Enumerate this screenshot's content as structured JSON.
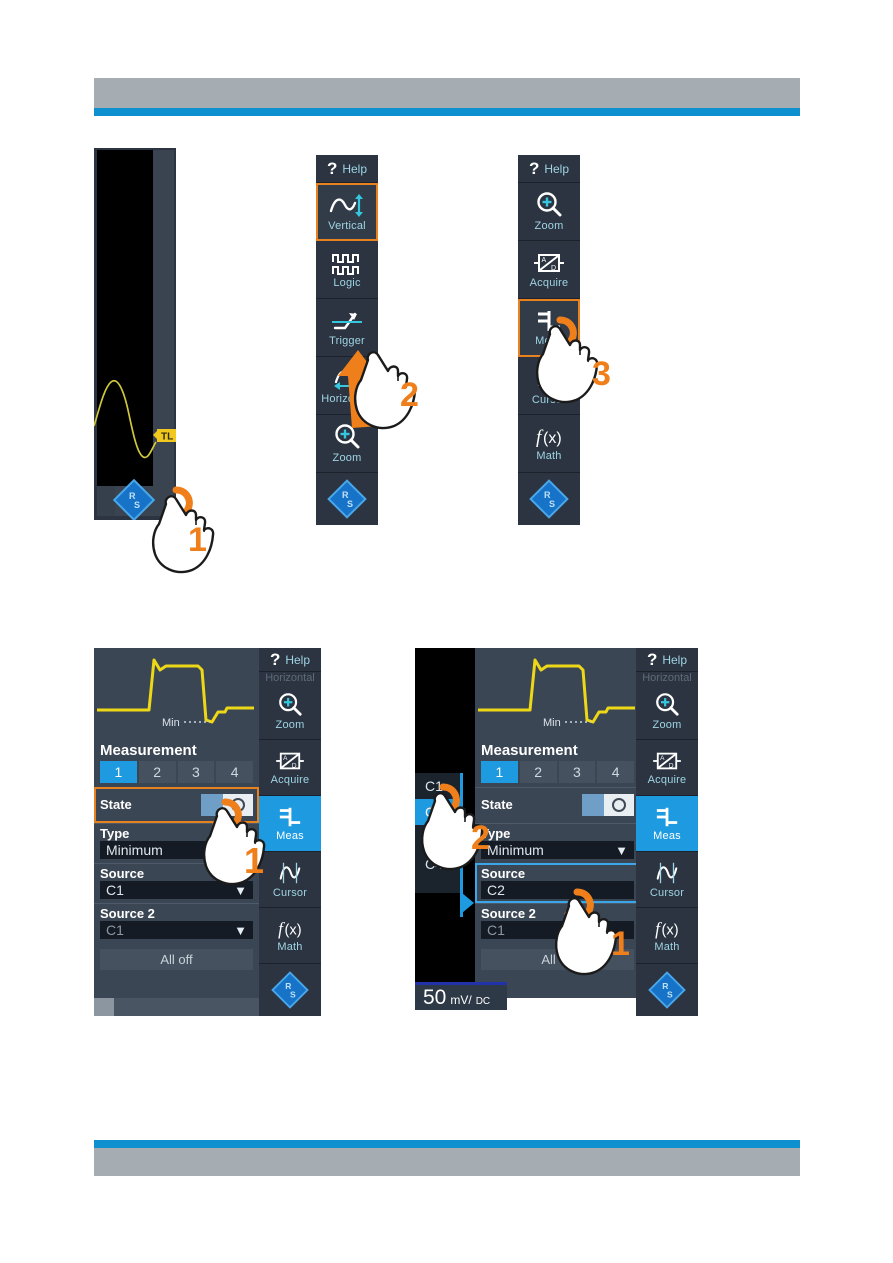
{
  "page": {
    "header_bar_color": "#a5adb2",
    "accent_blue": "#0d8fd0"
  },
  "figures": [
    {
      "id": "fig-step1-logo",
      "name": "scope-screen-with-rs-logo",
      "trigger_label": "TL",
      "step": "1"
    },
    {
      "id": "fig-step2-toolbar",
      "name": "toolbar-scroll-up",
      "step": "2",
      "help_label": "Help",
      "items": [
        {
          "label": "Vertical",
          "icon": "vertical-icon",
          "selected": true
        },
        {
          "label": "Logic",
          "icon": "logic-icon",
          "selected": false
        },
        {
          "label": "Trigger",
          "icon": "trigger-icon",
          "selected": false
        },
        {
          "label": "Horizontal",
          "icon": "horizontal-icon",
          "selected": false
        },
        {
          "label": "Zoom",
          "icon": "zoom-icon",
          "selected": false
        }
      ],
      "logo": "rohde-schwarz-logo"
    },
    {
      "id": "fig-step3-meas",
      "name": "toolbar-select-meas",
      "step": "3",
      "help_label": "Help",
      "items": [
        {
          "label": "Zoom",
          "icon": "zoom-icon",
          "selected": false
        },
        {
          "label": "Acquire",
          "icon": "acquire-icon",
          "selected": false
        },
        {
          "label": "Meas",
          "icon": "meas-icon",
          "selected": true
        },
        {
          "label": "Cursor",
          "icon": "cursor-icon",
          "selected": false
        },
        {
          "label": "Math",
          "icon": "math-icon",
          "selected": false
        }
      ],
      "logo": "rohde-schwarz-logo"
    },
    {
      "id": "fig-meas-dialog-state",
      "name": "measurement-dialog-enable-state",
      "step": "1",
      "waveform_label": "Min",
      "dialog": {
        "title": "Measurement",
        "tabs": [
          "1",
          "2",
          "3",
          "4"
        ],
        "active_tab": "1",
        "fields": [
          {
            "key": "State",
            "value": "",
            "kind": "toggle",
            "highlight": "orange"
          },
          {
            "key": "Type",
            "value": "Minimum",
            "kind": "dropdown"
          },
          {
            "key": "Source",
            "value": "C1",
            "kind": "dropdown"
          },
          {
            "key": "Source 2",
            "value": "C1",
            "kind": "dropdown",
            "dim": true
          }
        ],
        "all_off_label": "All off"
      },
      "toolbar": {
        "help_label": "Help",
        "cut_label": "Horizontal",
        "items": [
          {
            "label": "Zoom",
            "icon": "zoom-icon",
            "selected": false
          },
          {
            "label": "Acquire",
            "icon": "acquire-icon",
            "selected": false
          },
          {
            "label": "Meas",
            "icon": "meas-icon",
            "selected": true
          },
          {
            "label": "Cursor",
            "icon": "cursor-icon",
            "selected": false
          },
          {
            "label": "Math",
            "icon": "math-icon",
            "selected": false
          }
        ],
        "logo": "rohde-schwarz-logo"
      }
    },
    {
      "id": "fig-meas-dialog-source",
      "name": "measurement-dialog-select-source",
      "steps": [
        "1",
        "2"
      ],
      "waveform_label": "Min",
      "vertical_scale": {
        "value": "50",
        "unit": "mV/",
        "coupling": "DC"
      },
      "channel_list": {
        "options": [
          "C1",
          "C2",
          "C3",
          "C4"
        ],
        "selected": "C2"
      },
      "dialog": {
        "title": "Measurement",
        "tabs": [
          "1",
          "2",
          "3",
          "4"
        ],
        "active_tab": "1",
        "fields": [
          {
            "key": "State",
            "value": "",
            "kind": "toggle"
          },
          {
            "key": "Type",
            "value": "Minimum",
            "kind": "dropdown"
          },
          {
            "key": "Source",
            "value": "C2",
            "kind": "dropdown",
            "highlight": "blue"
          },
          {
            "key": "Source 2",
            "value": "C1",
            "kind": "dropdown",
            "dim": true
          }
        ],
        "all_off_label": "All off"
      },
      "toolbar": {
        "help_label": "Help",
        "cut_label": "Horizontal",
        "items": [
          {
            "label": "Zoom",
            "icon": "zoom-icon",
            "selected": false
          },
          {
            "label": "Acquire",
            "icon": "acquire-icon",
            "selected": false
          },
          {
            "label": "Meas",
            "icon": "meas-icon",
            "selected": true
          },
          {
            "label": "Cursor",
            "icon": "cursor-icon",
            "selected": false
          },
          {
            "label": "Math",
            "icon": "math-icon",
            "selected": false
          }
        ],
        "logo": "rohde-schwarz-logo"
      }
    }
  ]
}
